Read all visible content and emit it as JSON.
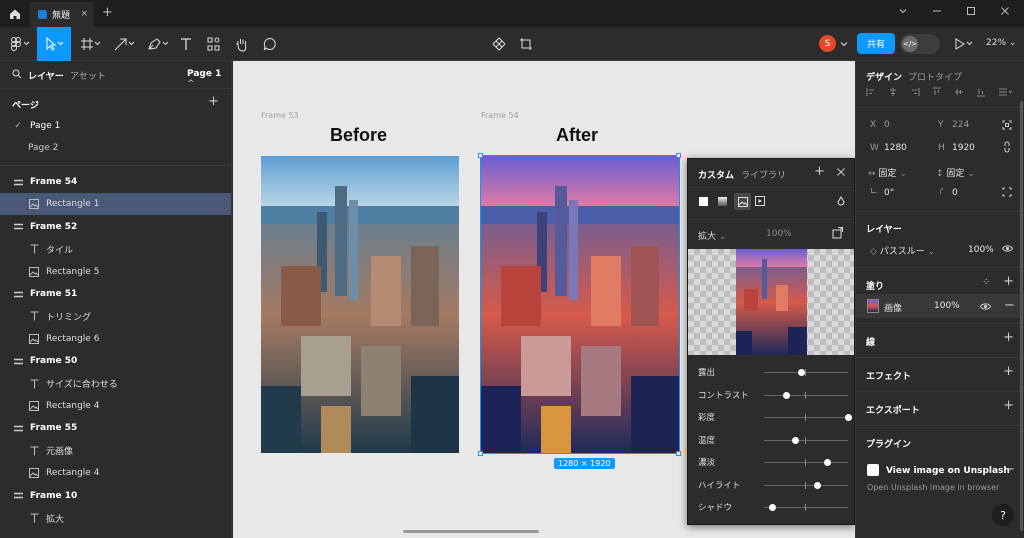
{
  "titlebar": {
    "tab_title": "無題",
    "tab_close": "×",
    "new_tab": "+"
  },
  "toolbar": {
    "avatar_initial": "S",
    "share_label": "共有",
    "devmode_label": "</>",
    "zoom": "22%"
  },
  "left_panel": {
    "tab_layers": "レイヤー",
    "tab_assets": "アセット",
    "page_selector": "Page 1",
    "pages_header": "ページ",
    "pages": [
      {
        "label": "Page 1",
        "current": true
      },
      {
        "label": "Page 2",
        "current": false
      }
    ],
    "layers": [
      {
        "label": "Frame 54",
        "kind": "frame"
      },
      {
        "label": "Rectangle 1",
        "kind": "image",
        "selected": true
      },
      {
        "label": "Frame 52",
        "kind": "frame"
      },
      {
        "label": "タイル",
        "kind": "text"
      },
      {
        "label": "Rectangle 5",
        "kind": "image"
      },
      {
        "label": "Frame 51",
        "kind": "frame"
      },
      {
        "label": "トリミング",
        "kind": "text"
      },
      {
        "label": "Rectangle 6",
        "kind": "image"
      },
      {
        "label": "Frame 50",
        "kind": "frame"
      },
      {
        "label": "サイズに合わせる",
        "kind": "text"
      },
      {
        "label": "Rectangle 4",
        "kind": "image"
      },
      {
        "label": "Frame 55",
        "kind": "frame"
      },
      {
        "label": "元画像",
        "kind": "text"
      },
      {
        "label": "Rectangle 4",
        "kind": "image"
      },
      {
        "label": "Frame 10",
        "kind": "frame"
      },
      {
        "label": "拡大",
        "kind": "text"
      }
    ]
  },
  "canvas": {
    "frame53_label": "Frame 53",
    "frame54_label": "Frame 54",
    "before_label": "Before",
    "after_label": "After",
    "size_badge": "1280 × 1920"
  },
  "popover": {
    "tab_custom": "カスタム",
    "tab_library": "ライブラリ",
    "scale_mode": "拡大",
    "opacity": "100%",
    "sliders": [
      {
        "label": "露出",
        "value": 0.45
      },
      {
        "label": "コントラスト",
        "value": 0.27
      },
      {
        "label": "彩度",
        "value": 1.0
      },
      {
        "label": "温度",
        "value": 0.37
      },
      {
        "label": "濃淡",
        "value": 0.76
      },
      {
        "label": "ハイライト",
        "value": 0.64
      },
      {
        "label": "シャドウ",
        "value": 0.1
      }
    ]
  },
  "right_panel": {
    "tab_design": "デザイン",
    "tab_prototype": "プロトタイプ",
    "x_label": "X",
    "x_value": "0",
    "y_label": "Y",
    "y_value": "224",
    "w_label": "W",
    "w_value": "1280",
    "h_label": "H",
    "h_value": "1920",
    "fix_w": "固定",
    "fix_h": "固定",
    "rotation": "0°",
    "radius": "0",
    "layer_header": "レイヤー",
    "blend_mode": "パススルー",
    "layer_opacity": "100%",
    "fill_header": "塗り",
    "fill_type": "画像",
    "fill_opacity": "100%",
    "stroke_header": "線",
    "effect_header": "エフェクト",
    "export_header": "エクスポート",
    "plugin_header": "プラグイン",
    "plugin_name": "View image on Unsplash",
    "plugin_desc": "Open Unsplash image in browser",
    "help": "?"
  },
  "colors": {
    "accent": "#0d99ff",
    "selected_row": "#4a5878",
    "panel": "#2c2c2c"
  }
}
